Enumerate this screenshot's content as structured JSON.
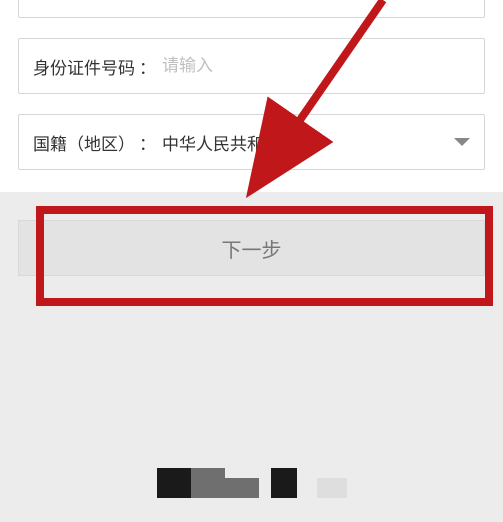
{
  "fields": {
    "id_number": {
      "label": "身份证件号码",
      "placeholder": "请输入",
      "value": ""
    },
    "nationality": {
      "label": "国籍（地区）",
      "value": "中华人民共和国"
    }
  },
  "buttons": {
    "next": "下一步"
  },
  "annotation": {
    "highlight_color": "#c0181a"
  }
}
